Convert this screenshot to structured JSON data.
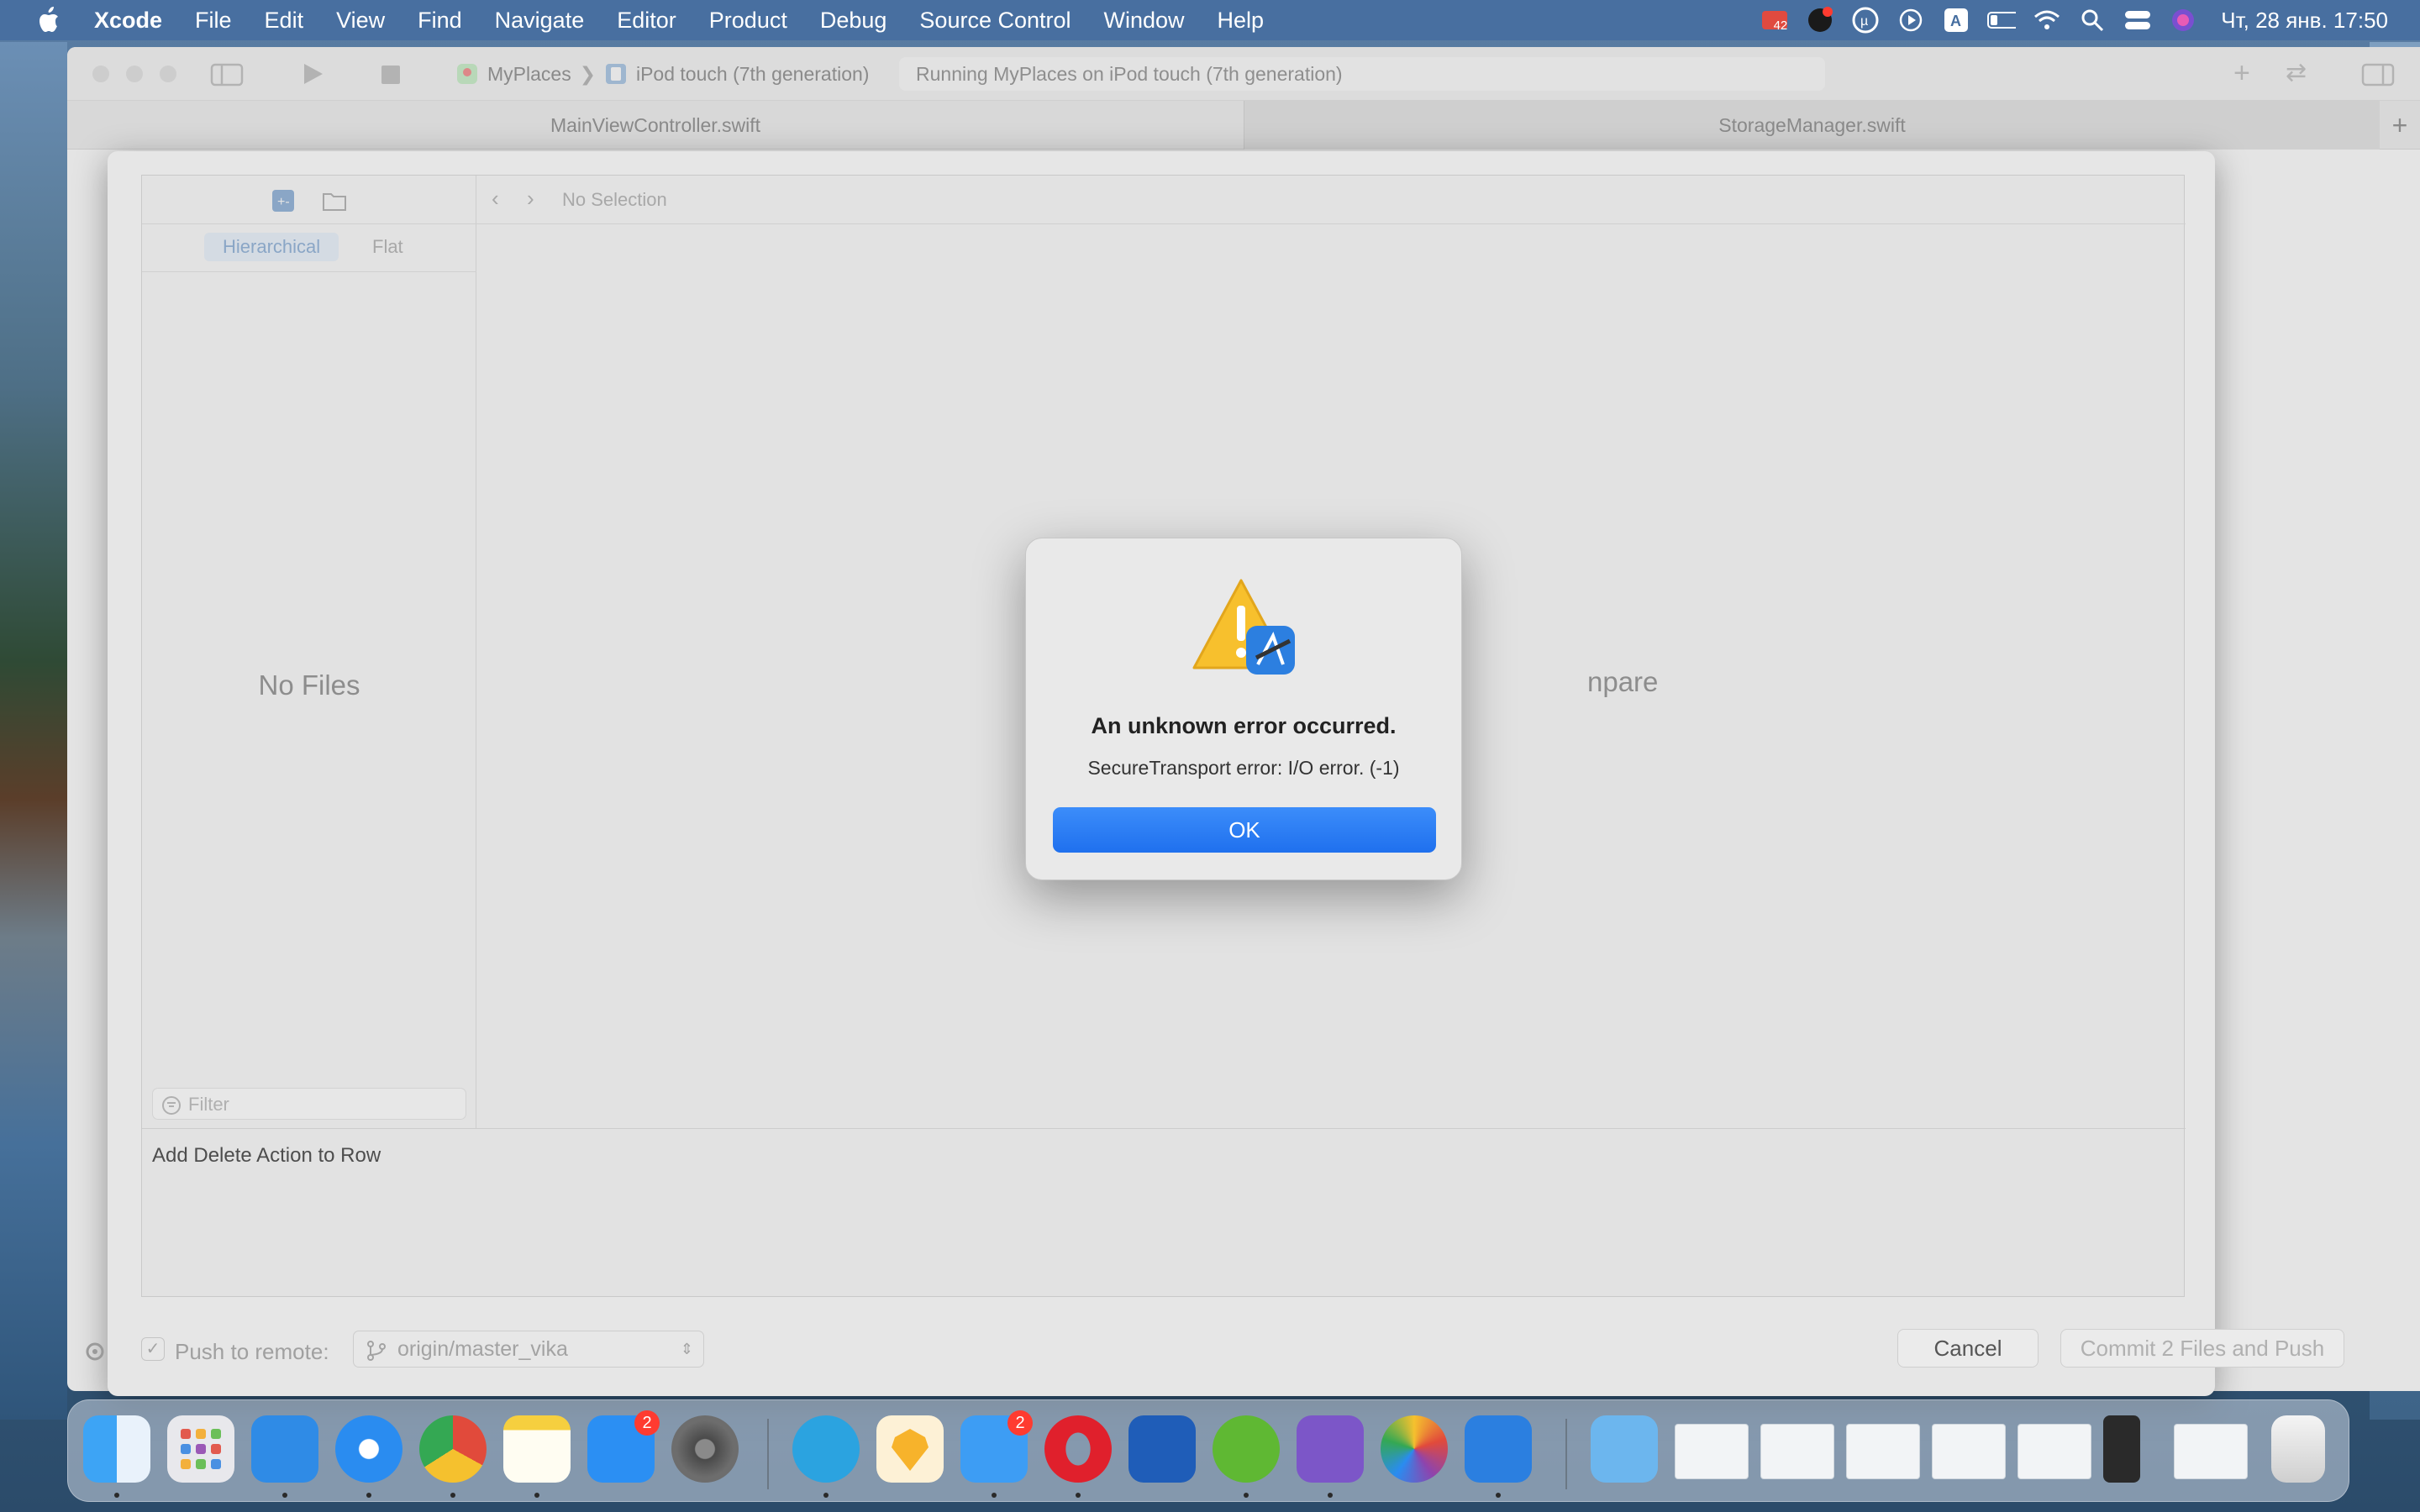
{
  "menubar": {
    "app": "Xcode",
    "items": [
      "File",
      "Edit",
      "View",
      "Find",
      "Navigate",
      "Editor",
      "Product",
      "Debug",
      "Source Control",
      "Window",
      "Help"
    ],
    "tray_badge": "42",
    "clock": "Чт, 28 янв.  17:50"
  },
  "toolbar": {
    "scheme_project": "MyPlaces",
    "scheme_device": "iPod touch (7th generation)",
    "activity": "Running MyPlaces on iPod touch (7th generation)"
  },
  "tabs": [
    "MainViewController.swift",
    "StorageManager.swift"
  ],
  "commit_sheet": {
    "segments": [
      "Hierarchical",
      "Flat"
    ],
    "no_selection": "No Selection",
    "no_files": "No Files",
    "compare_fragment": "npare",
    "filter_placeholder": "Filter",
    "commit_message": "Add Delete Action to Row",
    "push_label": "Push to remote:",
    "branch": "origin/master_vika",
    "cancel_label": "Cancel",
    "commit_label": "Commit 2 Files and Push"
  },
  "alert": {
    "title": "An unknown error occurred.",
    "message": "SecureTransport error: I/O error. (-1)",
    "ok_label": "OK"
  },
  "dock": {
    "appstore_badge": "2",
    "mail_badge": "2"
  },
  "colors": {
    "accent": "#1f70ee",
    "badge": "#ff3b30"
  }
}
